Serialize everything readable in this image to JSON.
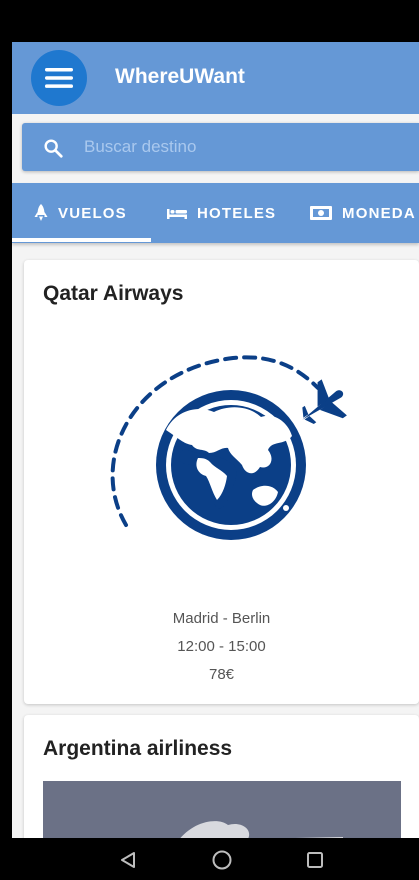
{
  "app": {
    "title": "WhereUWant"
  },
  "search": {
    "placeholder": "Buscar destino"
  },
  "tabs": [
    {
      "label": "VUELOS",
      "icon": "rocket-icon",
      "active": true
    },
    {
      "label": "HOTELES",
      "icon": "hotel-bed-icon",
      "active": false
    },
    {
      "label": "MONEDA",
      "icon": "money-icon",
      "active": false
    }
  ],
  "flights": [
    {
      "airline": "Qatar Airways",
      "route": "Madrid - Berlin",
      "time": "12:00 - 15:00",
      "price": "78€",
      "image": "globe-plane-icon"
    },
    {
      "airline": "Argentina airliness",
      "image": "airplane-photo"
    }
  ],
  "nav": {
    "back": "back-triangle-icon",
    "home": "home-circle-icon",
    "recents": "recents-square-icon"
  },
  "colors": {
    "primary": "#6598d6",
    "menu_button": "#1f78cf",
    "globe": "#0b3f87"
  }
}
